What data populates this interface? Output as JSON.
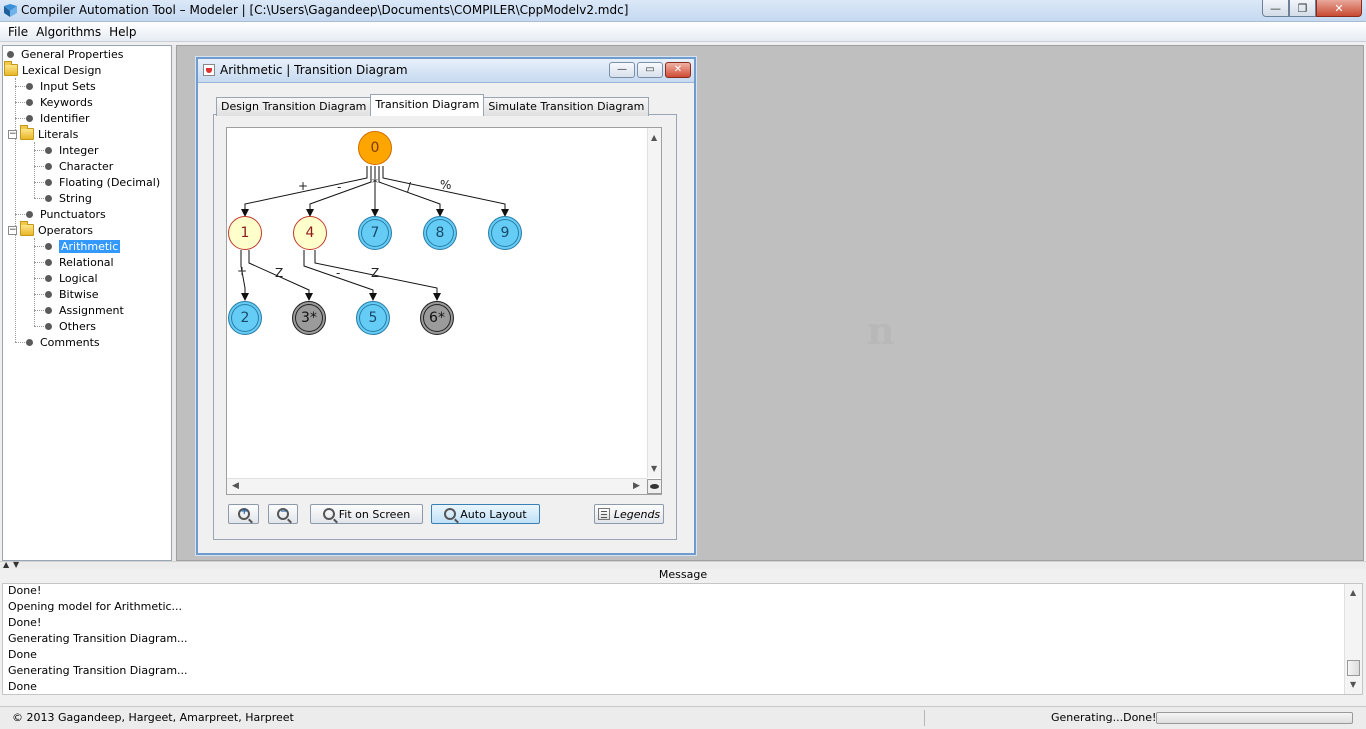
{
  "window": {
    "title": "Compiler Automation Tool – Modeler | [C:\\Users\\Gagandeep\\Documents\\COMPILER\\CppModelv2.mdc]",
    "minimize": "—",
    "maximize": "❐",
    "close": "✕"
  },
  "menu": [
    "File",
    "Algorithms",
    "Help"
  ],
  "tree": {
    "general_properties": "General Properties",
    "lexical_design": "Lexical Design",
    "input_sets": "Input Sets",
    "keywords": "Keywords",
    "identifier": "Identifier",
    "literals": "Literals",
    "integer": "Integer",
    "character": "Character",
    "floating": "Floating (Decimal)",
    "string": "String",
    "punctuators": "Punctuators",
    "operators": "Operators",
    "arithmetic": "Arithmetic",
    "relational": "Relational",
    "logical": "Logical",
    "bitwise": "Bitwise",
    "assignment": "Assignment",
    "others": "Others",
    "comments": "Comments",
    "expander_minus": "−"
  },
  "desktop": {
    "watermark": "n"
  },
  "frame": {
    "title": "Arithmetic | Transition Diagram",
    "minimize": "—",
    "maximize": "▭",
    "close": "✕",
    "tabs": [
      "Design Transition Diagram",
      "Transition Diagram",
      "Simulate Transition Diagram"
    ],
    "active_tab": "Transition Diagram",
    "nodes": {
      "n0": "0",
      "n1": "1",
      "n4": "4",
      "n7": "7",
      "n8": "8",
      "n9": "9",
      "n2": "2",
      "n3": "3*",
      "n5": "5",
      "n6": "6*"
    },
    "edge_labels": {
      "e0_1": "+",
      "e0_4": "-",
      "e0_7": "*",
      "e0_8": "/",
      "e0_9": "%",
      "e1_2": "+",
      "e1_3": "Z",
      "e4_5": "-",
      "e4_6": "Z"
    },
    "buttons": {
      "zoom_in": "+",
      "zoom_out": "−",
      "fit_on_screen": "Fit on Screen",
      "auto_layout": "Auto Layout",
      "legends": "Legends"
    }
  },
  "messages": {
    "header": "Message",
    "lines": [
      "Done!",
      "Opening model for Arithmetic...",
      "Done!",
      "Generating Transition Diagram...",
      "Done",
      "Generating Transition Diagram...",
      "Done"
    ]
  },
  "status": {
    "copyright": "© 2013 Gagandeep, Hargeet, Amarpreet, Harpreet",
    "state": "Generating...Done!",
    "progress": 0
  },
  "scroll_arrows": {
    "up": "▲",
    "down": "▼",
    "left": "◀",
    "right": "▶"
  },
  "colors": {
    "start_state": "#ffa500",
    "intermediate_state": "#ffffcc",
    "final_state": "#65cdf5",
    "retract_state": "#9b9b9b",
    "selection": "#3399ff"
  }
}
